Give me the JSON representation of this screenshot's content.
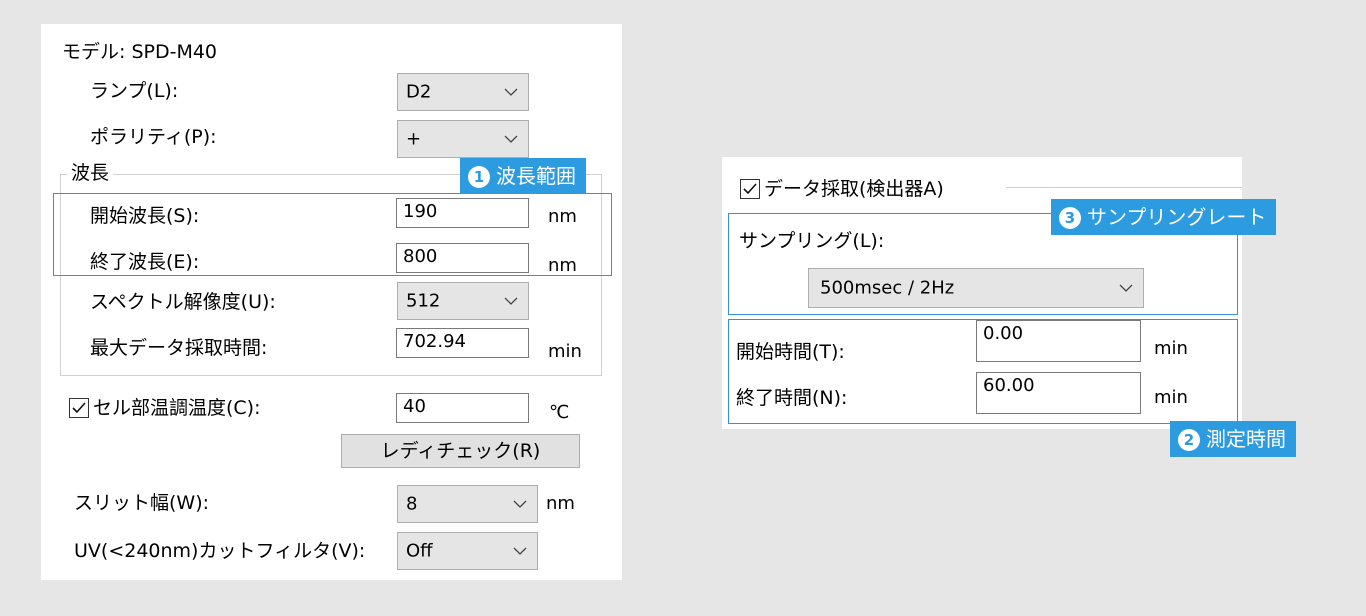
{
  "left_panel": {
    "model_label": "モデル: SPD-M40",
    "lamp": {
      "label": "ランプ(L):",
      "value": "D2"
    },
    "polarity": {
      "label": "ポラリティ(P):",
      "value": "+"
    },
    "wavelength_group": {
      "title": "波長",
      "start": {
        "label": "開始波長(S):",
        "value": "190",
        "unit": "nm"
      },
      "end": {
        "label": "終了波長(E):",
        "value": "800",
        "unit": "nm"
      },
      "resolution": {
        "label": "スペクトル解像度(U):",
        "value": "512"
      },
      "max_time": {
        "label": "最大データ採取時間:",
        "value": "702.94",
        "unit": "min"
      }
    },
    "cell_temp": {
      "label": "セル部温調温度(C):",
      "checked": true,
      "value": "40",
      "unit": "℃"
    },
    "ready_check_button": "レディチェック(R)",
    "slit_width": {
      "label": "スリット幅(W):",
      "value": "8",
      "unit": "nm"
    },
    "uv_filter": {
      "label": "UV(<240nm)カットフィルタ(V):",
      "value": "Off"
    }
  },
  "right_panel": {
    "acquisition": {
      "label": "データ採取(検出器A)",
      "checked": true
    },
    "sampling": {
      "label": "サンプリング(L):",
      "value": "500msec / 2Hz"
    },
    "start_time": {
      "label": "開始時間(T):",
      "value": "0.00",
      "unit": "min"
    },
    "end_time": {
      "label": "終了時間(N):",
      "value": "60.00",
      "unit": "min"
    }
  },
  "badges": {
    "wavelength_range": {
      "num": "1",
      "text": "波長範囲"
    },
    "measurement_time": {
      "num": "2",
      "text": "測定時間"
    },
    "sampling_rate": {
      "num": "3",
      "text": "サンプリングレート"
    }
  },
  "colors": {
    "highlight": "#2c9be0",
    "background": "#e6e6e6"
  }
}
